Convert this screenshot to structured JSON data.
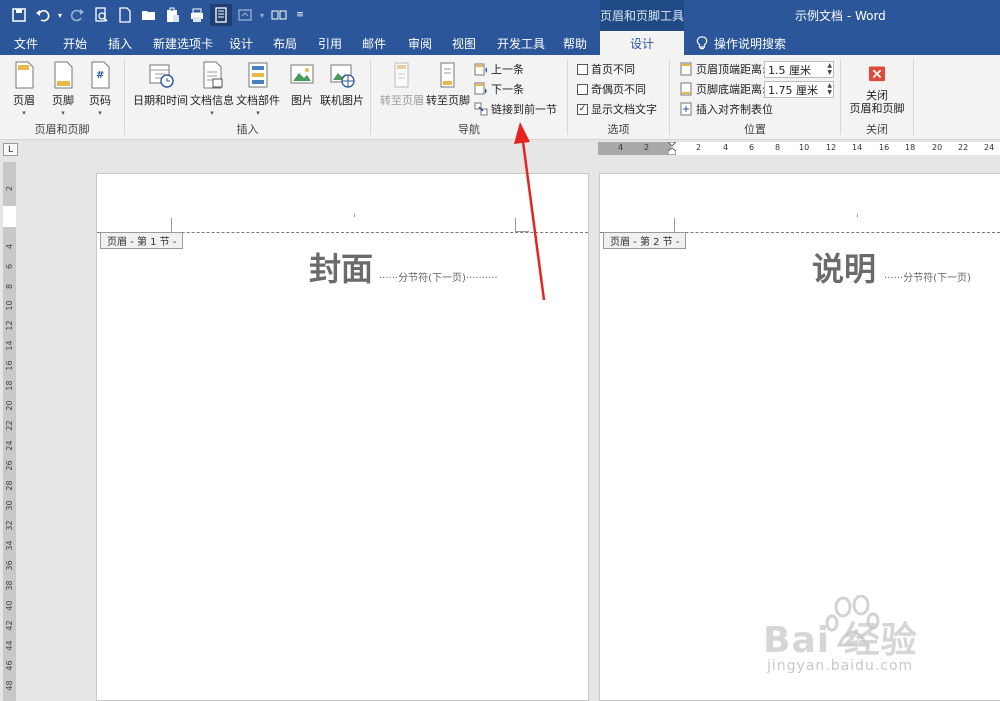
{
  "window": {
    "doc_title": "示例文档  -  Word",
    "tool_tab_title": "页眉和页脚工具"
  },
  "tabs": [
    {
      "label": "文件"
    },
    {
      "label": "开始"
    },
    {
      "label": "插入"
    },
    {
      "label": "新建选项卡"
    },
    {
      "label": "设计"
    },
    {
      "label": "布局"
    },
    {
      "label": "引用"
    },
    {
      "label": "邮件"
    },
    {
      "label": "审阅"
    },
    {
      "label": "视图"
    },
    {
      "label": "开发工具"
    },
    {
      "label": "帮助"
    },
    {
      "label": "设计"
    }
  ],
  "tell_me": "操作说明搜索",
  "ribbon": {
    "group_header_footer": {
      "label": "页眉和页脚",
      "header": "页眉",
      "footer": "页脚",
      "page_number": "页码"
    },
    "group_insert": {
      "label": "插入",
      "date_time": "日期和时间",
      "doc_info": "文档信息",
      "doc_parts": "文档部件",
      "picture": "图片",
      "online_picture": "联机图片"
    },
    "group_nav": {
      "label": "导航",
      "goto_header": "转至页眉",
      "goto_footer": "转至页脚",
      "previous": "上一条",
      "next": "下一条",
      "link_previous": "链接到前一节"
    },
    "group_options": {
      "label": "选项",
      "diff_first": "首页不同",
      "diff_odd_even": "奇偶页不同",
      "show_text": "显示文档文字"
    },
    "group_position": {
      "label": "位置",
      "header_top_label": "页眉顶端距离:",
      "header_top_value": "1.5 厘米",
      "footer_bottom_label": "页脚底端距离:",
      "footer_bottom_value": "1.75 厘米",
      "insert_align_tab": "插入对齐制表位"
    },
    "group_close": {
      "label": "关闭",
      "close_line1": "关闭",
      "close_line2": "页眉和页脚"
    }
  },
  "ruler": {
    "corner": "L",
    "h_ticks": [
      "4",
      "2",
      "2",
      "4",
      "6",
      "8",
      "10",
      "12",
      "14",
      "16",
      "18",
      "20",
      "22",
      "24"
    ],
    "v_ticks": [
      "2",
      "2",
      "4",
      "6",
      "8",
      "10",
      "12",
      "14",
      "16",
      "18",
      "20",
      "22",
      "24",
      "26",
      "28",
      "30",
      "32",
      "34",
      "36",
      "38",
      "40",
      "42",
      "44",
      "46",
      "48"
    ]
  },
  "pages": [
    {
      "header_tag": "页眉 - 第 1 节 -",
      "title": "封面",
      "section_break": "分节符(下一页)"
    },
    {
      "header_tag": "页眉 - 第 2 节 -",
      "title": "说明",
      "section_break": "分节符(下一页)"
    }
  ],
  "watermark": {
    "word": "Bai  经验",
    "url": "jingyan.baidu.com"
  },
  "colors": {
    "accent": "#2b579a",
    "close_red": "#e04a3a",
    "annotation": "#e8231f"
  }
}
